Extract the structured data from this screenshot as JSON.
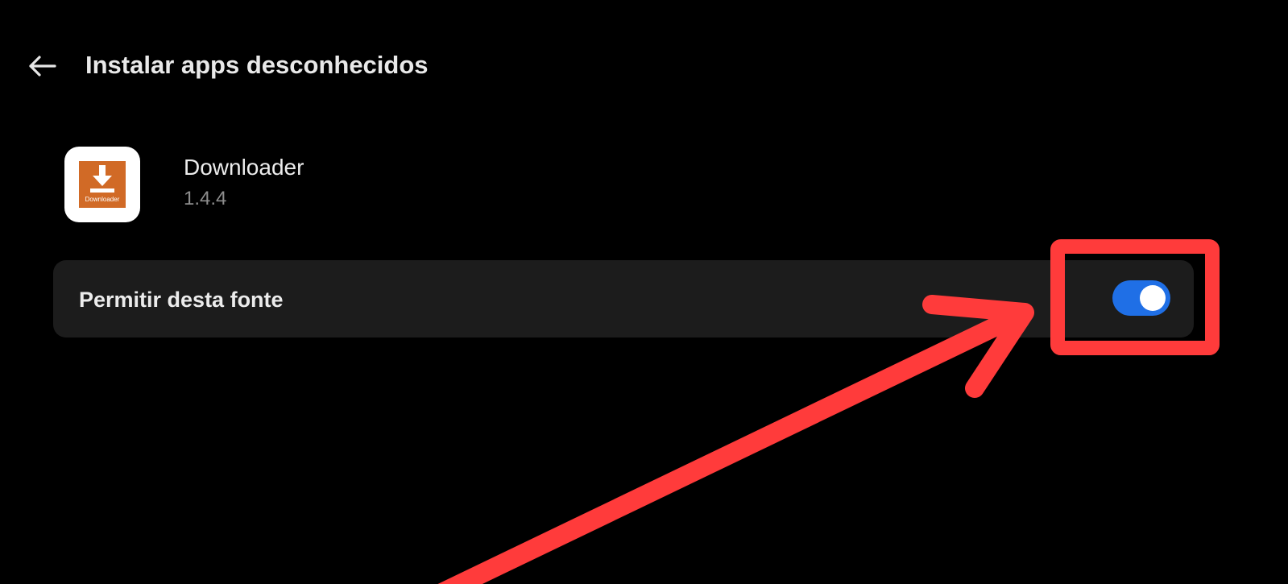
{
  "header": {
    "title": "Instalar apps desconhecidos",
    "back_icon": "arrow-left-icon"
  },
  "app": {
    "name": "Downloader",
    "version": "1.4.4",
    "icon_label": "Downloader",
    "icon_name": "download-arrow-icon",
    "icon_color": "#d16a26"
  },
  "setting": {
    "label": "Permitir desta fonte",
    "enabled": true,
    "toggle_color": "#1f6fe6"
  },
  "annotation": {
    "color": "#ff3b3b"
  }
}
